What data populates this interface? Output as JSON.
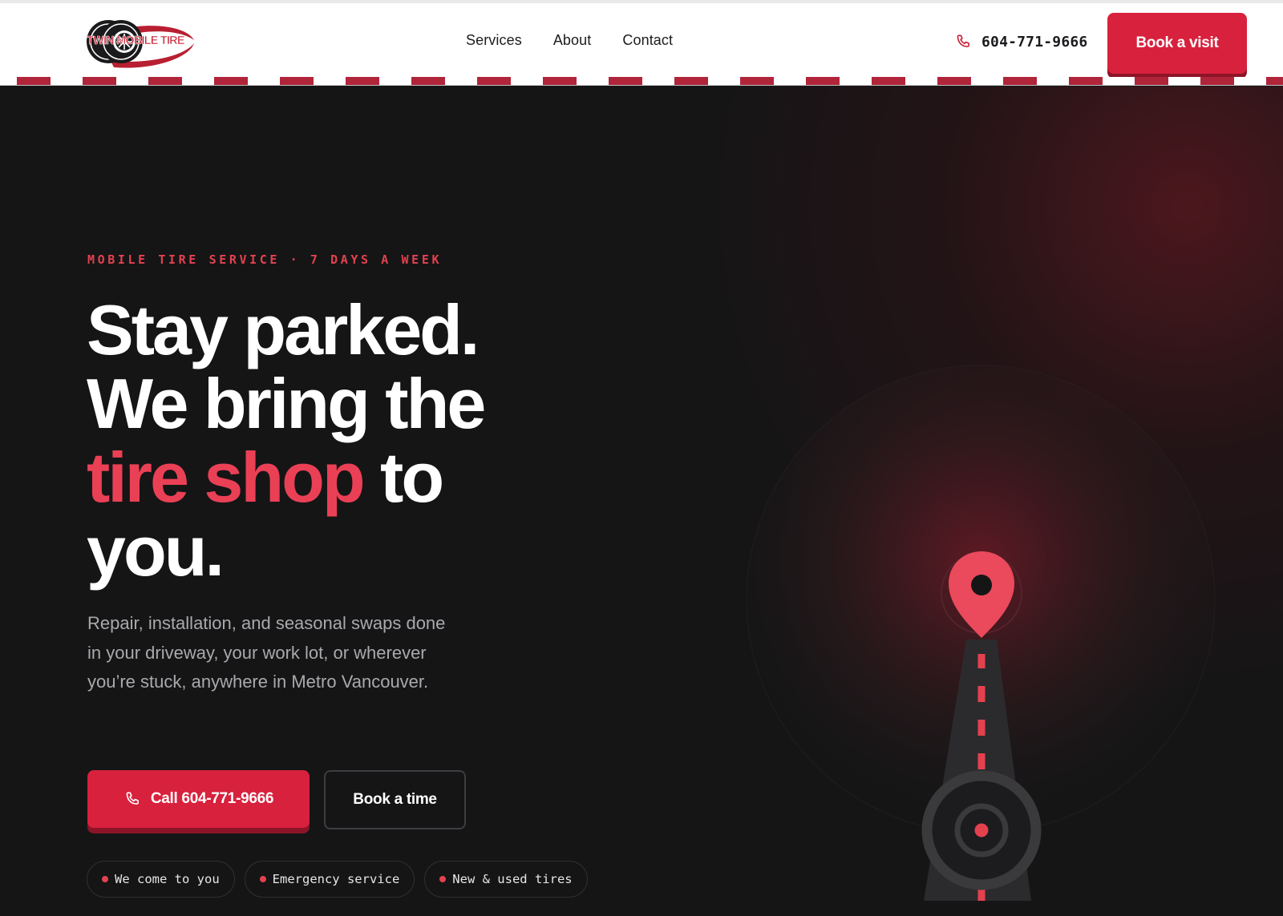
{
  "brand": {
    "logo_text": "TWIN MOBILE TIRE",
    "primary_color": "#d8213d",
    "accent_color": "#ea4055",
    "dark_bg": "#151516"
  },
  "header": {
    "nav": [
      {
        "label": "Services"
      },
      {
        "label": "About"
      },
      {
        "label": "Contact"
      }
    ],
    "phone": "604-771-9666",
    "phone_icon": "phone-icon",
    "cta_label": "Book a visit"
  },
  "hero": {
    "eyebrow": "MOBILE TIRE SERVICE · 7 DAYS A WEEK",
    "headline": {
      "line1": "Stay parked.",
      "line2": "We bring the",
      "accent": "tire shop",
      "line3_rest": " to",
      "line4": "you."
    },
    "subtext": "Repair, installation, and seasonal swaps done in your driveway, your work lot, or wherever you’re stuck, anywhere in Metro Vancouver.",
    "call_button": "Call 604-771-9666",
    "book_button": "Book a time",
    "pills": [
      {
        "label": "We come to you"
      },
      {
        "label": "Emergency service"
      },
      {
        "label": "New & used tires"
      }
    ],
    "illustration_icons": [
      "location-pin-icon",
      "road-icon",
      "tire-icon"
    ]
  }
}
